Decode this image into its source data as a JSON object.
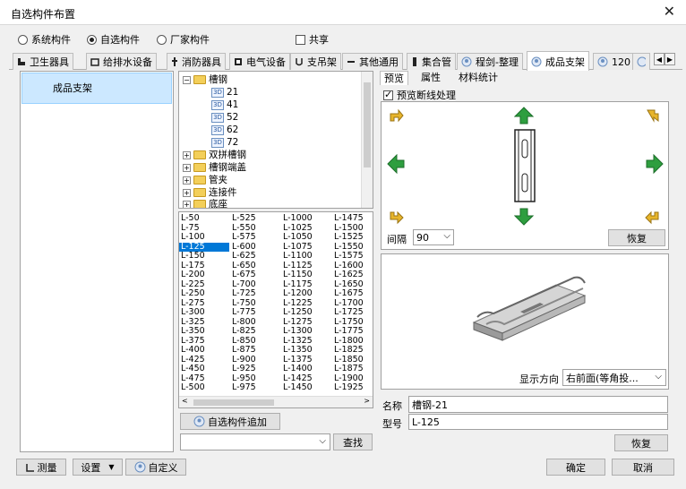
{
  "window": {
    "title": "自选构件布置",
    "close_glyph": "✕"
  },
  "source": {
    "options": [
      {
        "label": "系统构件",
        "selected": false
      },
      {
        "label": "自选构件",
        "selected": true
      },
      {
        "label": "厂家构件",
        "selected": false
      }
    ],
    "share_label": "共享"
  },
  "tabs": [
    {
      "label": "卫生器具",
      "icon": "toilet-icon"
    },
    {
      "label": "给排水设备",
      "icon": "pump-icon"
    },
    {
      "label": "消防器具",
      "icon": "fire-icon"
    },
    {
      "label": "电气设备",
      "icon": "electric-icon"
    },
    {
      "label": "支吊架",
      "icon": "hanger-icon"
    },
    {
      "label": "其他通用",
      "icon": "dash-icon"
    },
    {
      "label": "集合管",
      "icon": "manifold-icon"
    },
    {
      "label": "程剑-整理",
      "icon": "component-icon"
    },
    {
      "label": "成品支架",
      "icon": "component-icon",
      "active": true
    },
    {
      "label": "120",
      "icon": "component-icon"
    }
  ],
  "left_list": {
    "items": [
      "成品支架"
    ]
  },
  "tree": {
    "root": "槽钢",
    "children": [
      "21",
      "41",
      "52",
      "62",
      "72"
    ],
    "folders": [
      "双拼槽钢",
      "槽钢端盖",
      "管夹",
      "连接件",
      "底座"
    ]
  },
  "length_list": {
    "columns": [
      [
        "L-50",
        "L-75",
        "L-100",
        "L-125",
        "L-150",
        "L-175",
        "L-200",
        "L-225",
        "L-250",
        "L-275",
        "L-300",
        "L-325",
        "L-350",
        "L-375",
        "L-400",
        "L-425",
        "L-450",
        "L-475",
        "L-500"
      ],
      [
        "L-525",
        "L-550",
        "L-575",
        "L-600",
        "L-625",
        "L-650",
        "L-675",
        "L-700",
        "L-725",
        "L-750",
        "L-775",
        "L-800",
        "L-825",
        "L-850",
        "L-875",
        "L-900",
        "L-925",
        "L-950",
        "L-975"
      ],
      [
        "L-1000",
        "L-1025",
        "L-1050",
        "L-1075",
        "L-1100",
        "L-1125",
        "L-1150",
        "L-1175",
        "L-1200",
        "L-1225",
        "L-1250",
        "L-1275",
        "L-1300",
        "L-1325",
        "L-1350",
        "L-1375",
        "L-1400",
        "L-1425",
        "L-1450"
      ],
      [
        "L-1475",
        "L-1500",
        "L-1525",
        "L-1550",
        "L-1575",
        "L-1600",
        "L-1625",
        "L-1650",
        "L-1675",
        "L-1700",
        "L-1725",
        "L-1750",
        "L-1775",
        "L-1800",
        "L-1825",
        "L-1850",
        "L-1875",
        "L-1900",
        "L-1925"
      ]
    ],
    "selected": "L-125"
  },
  "buttons": {
    "add_custom": "自选构件追加",
    "find": "查找",
    "restore": "恢复",
    "restore2": "恢复",
    "measure": "测量",
    "settings": "设置",
    "customize": "自定义",
    "ok": "确定",
    "cancel": "取消"
  },
  "right_tabs": [
    "预览",
    "属性",
    "材料统计"
  ],
  "preview": {
    "break_label": "预览断线处理",
    "break_checked": true,
    "gap_label": "间隔",
    "gap_value": "90",
    "view_dir_label": "显示方向",
    "view_dir_value": "右前面(等角投..."
  },
  "props": {
    "name_label": "名称",
    "name_value": "槽钢-21",
    "model_label": "型号",
    "model_value": "L-125"
  },
  "colors": {
    "selection": "#0078d7",
    "left_highlight": "#cce8ff",
    "arrow_green": "#2e9e3f",
    "arrow_yellow": "#e7b52c"
  }
}
